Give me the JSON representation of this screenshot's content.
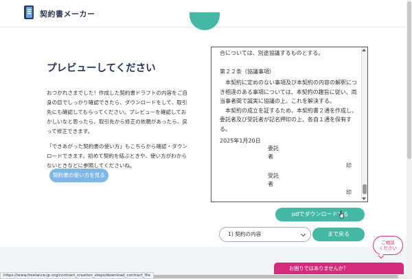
{
  "header": {
    "logo_text": "契約書メーカー"
  },
  "preview": {
    "title": "プレビューしてください",
    "desc1": "おつかれさまでした！作成した契約書ドラフトの内容をご自身の目でしっかり確認できたら、ダウンロードをして、取引先にも確認してもらってください。プレビューを確認しておかしいなと思ったら、取引先から修正の依頼があったら、戻って修正できます。",
    "desc2": "「できあがった契約書の使い方」もこちらから確認・ダウンロードできます。初めて契約を結ぶときや、使い方がわからないときなどに参照してくださいね。",
    "howto_button": "契約書の使い方を見る"
  },
  "document": {
    "line_top": "合については、別途協議するものとする。",
    "article_title": "第２２条（協議事項）",
    "para1": "本契約に定めのない事項及び本契約の内容の解釈につき相違のある事項については、本契約の趣旨に従い、両当事者間で誠実に協議の上、これを解決する。",
    "para2": "本契約の成立を証するため、本契約書２通を作成し、委託者及び受託者が記名押印の上、各自１通を保有する。",
    "date": "2025年1月20日",
    "sig1_label_a": "委託",
    "sig1_label_b": "者",
    "sig2_label_a": "受託",
    "sig2_label_b": "者",
    "seal": "印"
  },
  "actions": {
    "pdf_button": "pdfでダウンロードする",
    "select_value": "1) 契約の内容",
    "back_button": "まで戻る"
  },
  "help": {
    "bubble_line1": "ご相談",
    "bubble_line2": "ください",
    "banner": "お困りではありませんか？"
  },
  "status_url": "https://www.freelance-jp.org/contract_creation_steps/download_contract_file",
  "colors": {
    "teal": "#44b8a5",
    "navy": "#243555",
    "pink": "#d42b7c",
    "light_blue": "#7fb8e6"
  }
}
